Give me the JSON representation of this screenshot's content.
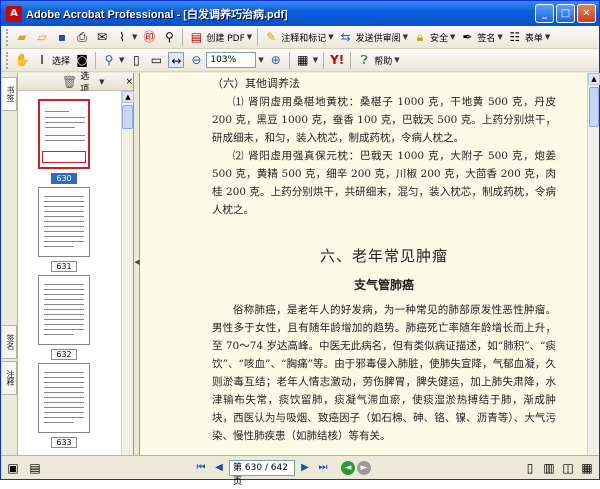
{
  "window": {
    "title": "Adobe Acrobat Professional - [白发调养巧治病.pdf]",
    "buttons": {
      "minimize": "_",
      "maximize": "□",
      "close": "✕"
    }
  },
  "toolbar1": {
    "create_pdf": "创建 PDF",
    "comment": "注释和标记",
    "send_review": "发送供审阅",
    "security": "安全",
    "sign": "签名",
    "forms": "表单"
  },
  "toolbar2": {
    "select": "选择",
    "zoom": "103%",
    "help": "帮助"
  },
  "sidebar": {
    "tabs": [
      "书签",
      "签名",
      "注释"
    ],
    "panel_options": "选项",
    "close": "×",
    "thumbnails": [
      {
        "label": "630",
        "selected": true
      },
      {
        "label": "631",
        "selected": false
      },
      {
        "label": "632",
        "selected": false
      },
      {
        "label": "633",
        "selected": false
      }
    ]
  },
  "document": {
    "subheading": "（六）其他调养法",
    "para1": "⑴ 肾阴虚用桑椹地黄枕：桑椹子 1000 克，干地黄 500 克，丹皮 200 克，黑豆 1000 克，蚕香 100 克，巴戟天 500 克。上药分别烘干，研成细末，和匀，装入枕芯，制成药枕，令病人枕之。",
    "para2": "⑵ 肾阳虚用强真保元枕：巴戟天 1000 克，大附子 500 克，炮姜 500 克，黄精 500 克，细辛 200 克，川椒 200 克，大茴香 200 克，肉桂 200 克。上药分别烘干，共研细末，混匀，装入枕芯，制成药枕，令病人枕之。",
    "chapter_title": "六、老年常见肿瘤",
    "section_title": "支气管肺癌",
    "para3": "俗称肺癌，是老年人的好发病，为一种常见的肺部原发性恶性肿瘤。男性多于女性，且有随年龄增加的趋势。肺癌死亡率随年龄增长而上升，至 70～74 岁达高峰。中医无此病名，但有类似病证描述，如“肺积”、“痰饮”、“咳血”、“胸痛”等。由于邪毒侵入肺脏，使肺失宣降，气郁血凝，久则淤毒互结；老年人情志激动，劳伤脾胃，脾失健运，加上肺失肃降，水津输布失常，痰饮留肺，痰凝气滞血瘀，使痰湿淤热搏结于肺，渐成肿块，西医认为与吸烟、致癌因子（如石棉、砷、铬、镍、沥青等）、大气污染、慢性肺疾患（如肺结核）等有关。"
  },
  "status": {
    "page_field": "第 630 / 642 页"
  }
}
